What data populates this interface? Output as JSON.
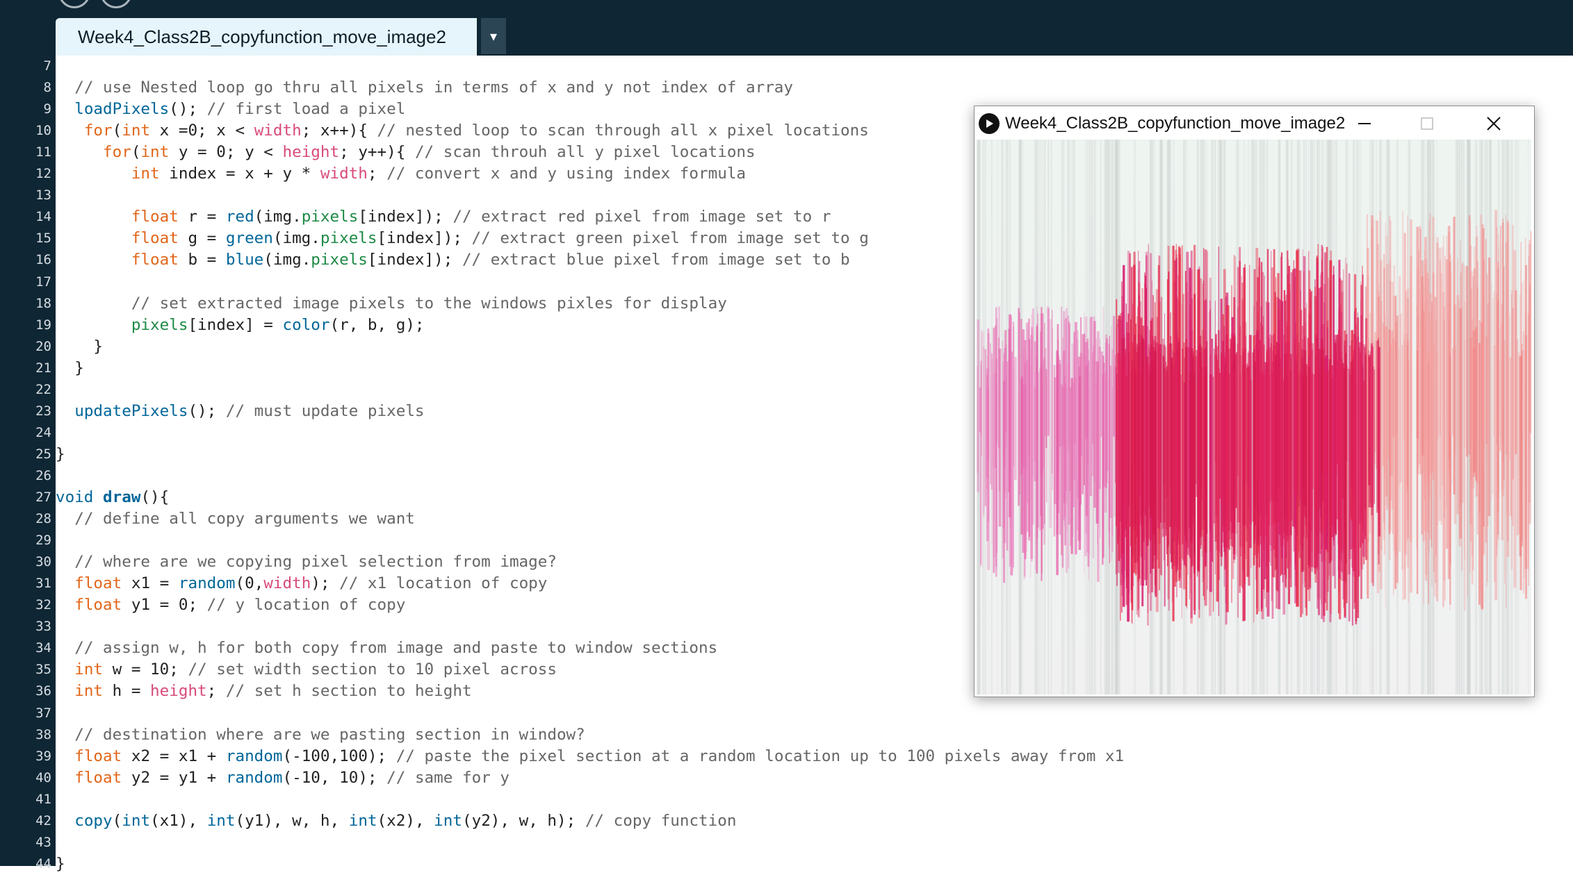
{
  "tab": {
    "title": "Week4_Class2B_copyfunction_move_image2",
    "dropdown_glyph": "▾"
  },
  "sketch_window": {
    "title": "Week4_Class2B_copyfunction_move_image2",
    "icon": "play-icon",
    "buttons": {
      "minimize": "minimize-icon",
      "maximize": "maximize-icon",
      "close": "close-icon"
    }
  },
  "colors": {
    "header_bg": "#0f2634",
    "tab_bg": "#e6f5fb",
    "comment": "#666666",
    "keyword": "#e2661a",
    "function": "#006699",
    "variable": "#d94a7a",
    "field": "#1e8a46"
  },
  "editor": {
    "lines": [
      {
        "n": "7",
        "tokens": []
      },
      {
        "n": "8",
        "tokens": [
          [
            "  ",
            "plain"
          ],
          [
            "// use Nested loop go thru all pixels in terms of x and y not index of array",
            "comment"
          ]
        ]
      },
      {
        "n": "9",
        "tokens": [
          [
            "  ",
            "plain"
          ],
          [
            "loadPixels",
            "function"
          ],
          [
            "(); ",
            "plain"
          ],
          [
            "// first load a pixel",
            "comment"
          ]
        ]
      },
      {
        "n": "10",
        "tokens": [
          [
            "   ",
            "plain"
          ],
          [
            "for",
            "keyword"
          ],
          [
            "(",
            "plain"
          ],
          [
            "int",
            "keyword"
          ],
          [
            " x =0; x < ",
            "plain"
          ],
          [
            "width",
            "var"
          ],
          [
            "; x++){ ",
            "plain"
          ],
          [
            "// nested loop to scan through all x pixel locations",
            "comment"
          ]
        ]
      },
      {
        "n": "11",
        "tokens": [
          [
            "     ",
            "plain"
          ],
          [
            "for",
            "keyword"
          ],
          [
            "(",
            "plain"
          ],
          [
            "int",
            "keyword"
          ],
          [
            " y = 0; y < ",
            "plain"
          ],
          [
            "height",
            "var"
          ],
          [
            "; y++){ ",
            "plain"
          ],
          [
            "// scan throuh all y pixel locations",
            "comment"
          ]
        ]
      },
      {
        "n": "12",
        "tokens": [
          [
            "        ",
            "plain"
          ],
          [
            "int",
            "keyword"
          ],
          [
            " index = x + y * ",
            "plain"
          ],
          [
            "width",
            "var"
          ],
          [
            "; ",
            "plain"
          ],
          [
            "// convert x and y using index formula",
            "comment"
          ]
        ]
      },
      {
        "n": "13",
        "tokens": []
      },
      {
        "n": "14",
        "tokens": [
          [
            "        ",
            "plain"
          ],
          [
            "float",
            "keyword"
          ],
          [
            " r = ",
            "plain"
          ],
          [
            "red",
            "function"
          ],
          [
            "(img.",
            "plain"
          ],
          [
            "pixels",
            "field"
          ],
          [
            "[index]); ",
            "plain"
          ],
          [
            "// extract red pixel from image set to r",
            "comment"
          ]
        ]
      },
      {
        "n": "15",
        "tokens": [
          [
            "        ",
            "plain"
          ],
          [
            "float",
            "keyword"
          ],
          [
            " g = ",
            "plain"
          ],
          [
            "green",
            "function"
          ],
          [
            "(img.",
            "plain"
          ],
          [
            "pixels",
            "field"
          ],
          [
            "[index]); ",
            "plain"
          ],
          [
            "// extract green pixel from image set to g",
            "comment"
          ]
        ]
      },
      {
        "n": "16",
        "tokens": [
          [
            "        ",
            "plain"
          ],
          [
            "float",
            "keyword"
          ],
          [
            " b = ",
            "plain"
          ],
          [
            "blue",
            "function"
          ],
          [
            "(img.",
            "plain"
          ],
          [
            "pixels",
            "field"
          ],
          [
            "[index]); ",
            "plain"
          ],
          [
            "// extract blue pixel from image set to b",
            "comment"
          ]
        ]
      },
      {
        "n": "17",
        "tokens": []
      },
      {
        "n": "18",
        "tokens": [
          [
            "        ",
            "plain"
          ],
          [
            "// set extracted image pixels to the windows pixles for display",
            "comment"
          ]
        ]
      },
      {
        "n": "19",
        "tokens": [
          [
            "        ",
            "plain"
          ],
          [
            "pixels",
            "field"
          ],
          [
            "[index] = ",
            "plain"
          ],
          [
            "color",
            "function"
          ],
          [
            "(r, b, g);",
            "plain"
          ]
        ]
      },
      {
        "n": "20",
        "tokens": [
          [
            "    }",
            "plain"
          ]
        ]
      },
      {
        "n": "21",
        "tokens": [
          [
            "  }",
            "plain"
          ]
        ]
      },
      {
        "n": "22",
        "tokens": []
      },
      {
        "n": "23",
        "tokens": [
          [
            "  ",
            "plain"
          ],
          [
            "updatePixels",
            "function"
          ],
          [
            "(); ",
            "plain"
          ],
          [
            "// must update pixels",
            "comment"
          ]
        ]
      },
      {
        "n": "24",
        "tokens": []
      },
      {
        "n": "25",
        "tokens": [
          [
            "}",
            "plain"
          ]
        ]
      },
      {
        "n": "26",
        "tokens": []
      },
      {
        "n": "27",
        "tokens": [
          [
            "void",
            "function"
          ],
          [
            " ",
            "plain"
          ],
          [
            "draw",
            "function-bold"
          ],
          [
            "(){",
            "plain"
          ]
        ]
      },
      {
        "n": "28",
        "tokens": [
          [
            "  ",
            "plain"
          ],
          [
            "// define all copy arguments we want",
            "comment"
          ]
        ]
      },
      {
        "n": "29",
        "tokens": []
      },
      {
        "n": "30",
        "tokens": [
          [
            "  ",
            "plain"
          ],
          [
            "// where are we copying pixel selection from image?",
            "comment"
          ]
        ]
      },
      {
        "n": "31",
        "tokens": [
          [
            "  ",
            "plain"
          ],
          [
            "float",
            "keyword"
          ],
          [
            " x1 = ",
            "plain"
          ],
          [
            "random",
            "function"
          ],
          [
            "(0,",
            "plain"
          ],
          [
            "width",
            "var"
          ],
          [
            "); ",
            "plain"
          ],
          [
            "// x1 location of copy",
            "comment"
          ]
        ]
      },
      {
        "n": "32",
        "tokens": [
          [
            "  ",
            "plain"
          ],
          [
            "float",
            "keyword"
          ],
          [
            " y1 = 0; ",
            "plain"
          ],
          [
            "// y location of copy",
            "comment"
          ]
        ]
      },
      {
        "n": "33",
        "tokens": []
      },
      {
        "n": "34",
        "tokens": [
          [
            "  ",
            "plain"
          ],
          [
            "// assign w, h for both copy from image and paste to window sections",
            "comment"
          ]
        ]
      },
      {
        "n": "35",
        "tokens": [
          [
            "  ",
            "plain"
          ],
          [
            "int",
            "keyword"
          ],
          [
            " w = 10; ",
            "plain"
          ],
          [
            "// set width section to 10 pixel across",
            "comment"
          ]
        ]
      },
      {
        "n": "36",
        "tokens": [
          [
            "  ",
            "plain"
          ],
          [
            "int",
            "keyword"
          ],
          [
            " h = ",
            "plain"
          ],
          [
            "height",
            "var"
          ],
          [
            "; ",
            "plain"
          ],
          [
            "// set h section to height",
            "comment"
          ]
        ]
      },
      {
        "n": "37",
        "tokens": []
      },
      {
        "n": "38",
        "tokens": [
          [
            "  ",
            "plain"
          ],
          [
            "// destination where are we pasting section in window?",
            "comment"
          ]
        ]
      },
      {
        "n": "39",
        "tokens": [
          [
            "  ",
            "plain"
          ],
          [
            "float",
            "keyword"
          ],
          [
            " x2 = x1 + ",
            "plain"
          ],
          [
            "random",
            "function"
          ],
          [
            "(-100,100); ",
            "plain"
          ],
          [
            "// paste the pixel section at a random location up to 100 pixels away from x1",
            "comment"
          ]
        ]
      },
      {
        "n": "40",
        "tokens": [
          [
            "  ",
            "plain"
          ],
          [
            "float",
            "keyword"
          ],
          [
            " y2 = y1 + ",
            "plain"
          ],
          [
            "random",
            "function"
          ],
          [
            "(-10, 10); ",
            "plain"
          ],
          [
            "// same for y",
            "comment"
          ]
        ]
      },
      {
        "n": "41",
        "tokens": []
      },
      {
        "n": "42",
        "tokens": [
          [
            "  ",
            "plain"
          ],
          [
            "copy",
            "function"
          ],
          [
            "(",
            "plain"
          ],
          [
            "int",
            "function"
          ],
          [
            "(x1), ",
            "plain"
          ],
          [
            "int",
            "function"
          ],
          [
            "(y1), w, h, ",
            "plain"
          ],
          [
            "int",
            "function"
          ],
          [
            "(x2), ",
            "plain"
          ],
          [
            "int",
            "function"
          ],
          [
            "(y2), w, h); ",
            "plain"
          ],
          [
            "// copy function",
            "comment"
          ]
        ]
      },
      {
        "n": "43",
        "tokens": []
      },
      {
        "n": "44",
        "tokens": [
          [
            "}",
            "plain"
          ]
        ]
      }
    ]
  }
}
